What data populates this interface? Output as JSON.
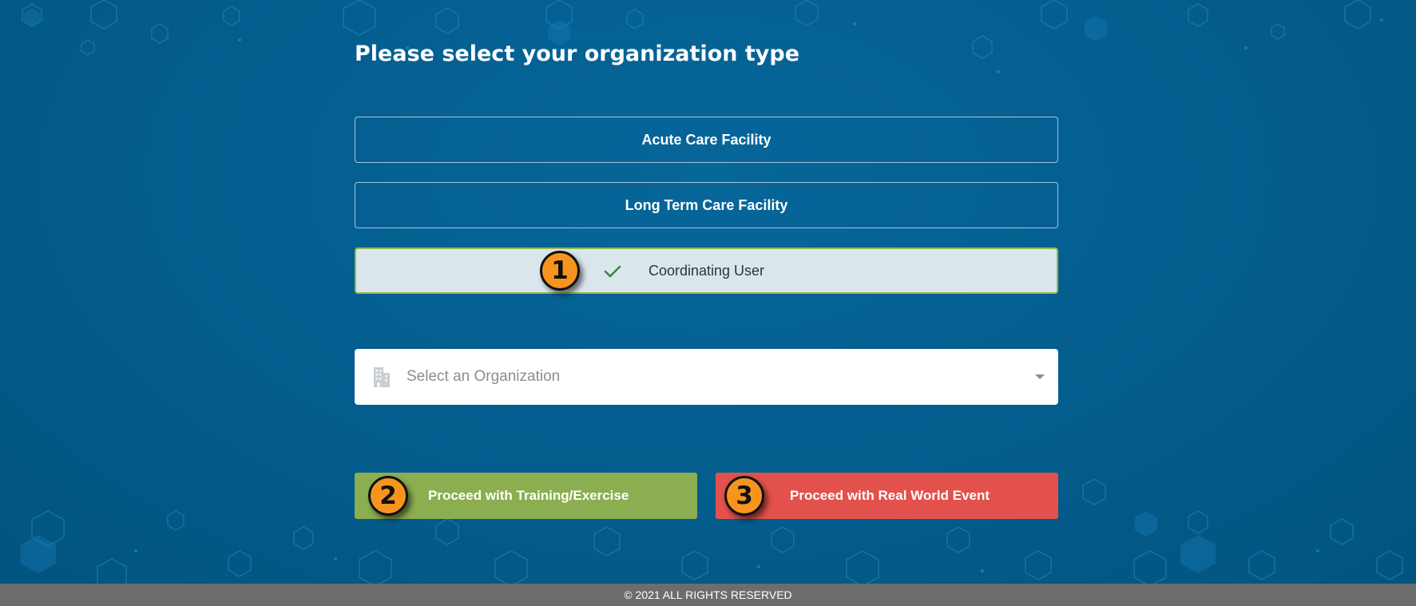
{
  "page": {
    "title": "Please select your organization type"
  },
  "org_types": [
    {
      "label": "Acute Care Facility",
      "selected": false
    },
    {
      "label": "Long Term Care Facility",
      "selected": false
    },
    {
      "label": "Coordinating User",
      "selected": true
    }
  ],
  "organization_select": {
    "placeholder": "Select an Organization",
    "icon": "building-icon"
  },
  "actions": {
    "training_label": "Proceed with Training/Exercise",
    "real_world_label": "Proceed with Real World Event"
  },
  "annotations": {
    "badge_1": "1",
    "badge_2": "2",
    "badge_3": "3"
  },
  "footer": {
    "text": "© 2021 ALL RIGHTS RESERVED"
  },
  "colors": {
    "background": "#045f8f",
    "selected_bg": "#d9e7ed",
    "training_button": "#8cae50",
    "real_world_button": "#e3514c",
    "badge": "#f7941e",
    "footer": "#6d6d6d"
  }
}
